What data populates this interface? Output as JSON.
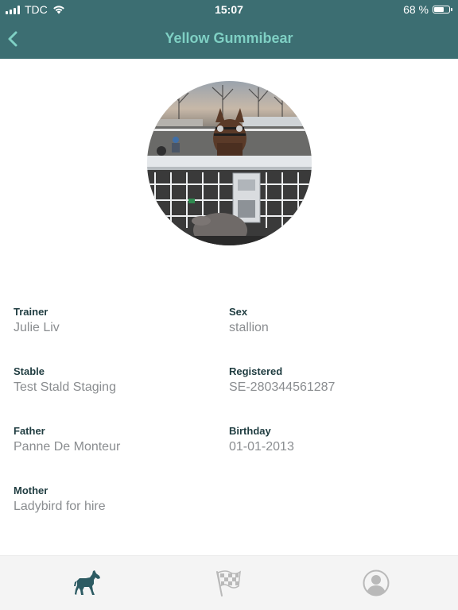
{
  "status_bar": {
    "carrier": "TDC",
    "time": "15:07",
    "battery_text": "68 %",
    "battery_level": 0.68
  },
  "nav": {
    "back_icon": "chevron-left-icon",
    "title": "Yellow Gummibear"
  },
  "profile": {
    "image": "horse-photo"
  },
  "details": {
    "trainer": {
      "label": "Trainer",
      "value": "Julie Liv"
    },
    "sex": {
      "label": "Sex",
      "value": "stallion"
    },
    "stable": {
      "label": "Stable",
      "value": "Test Stald Staging"
    },
    "registered": {
      "label": "Registered",
      "value": "SE-280344561287"
    },
    "father": {
      "label": "Father",
      "value": "Panne De Monteur"
    },
    "birthday": {
      "label": "Birthday",
      "value": "01-01-2013"
    },
    "mother": {
      "label": "Mother",
      "value": "Ladybird for hire"
    }
  },
  "tabs": [
    {
      "icon": "horse-icon",
      "active": true
    },
    {
      "icon": "checkered-flag-icon",
      "active": false
    },
    {
      "icon": "profile-icon",
      "active": false
    }
  ],
  "colors": {
    "header": "#3c6e72",
    "title": "#7fd0c4",
    "label": "#1f3c40",
    "value": "#8a8d90",
    "tab_active": "#2d5b63",
    "tab_inactive": "#b9b9b9"
  }
}
